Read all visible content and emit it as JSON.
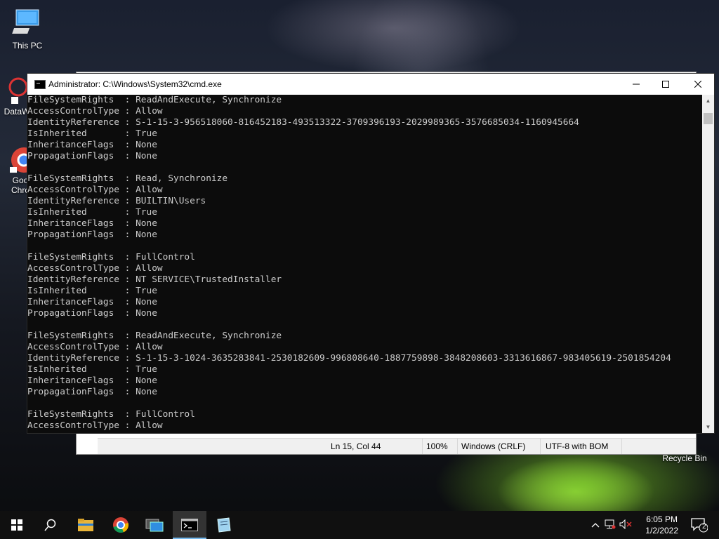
{
  "desktop": {
    "icons": [
      {
        "label": "This PC"
      },
      {
        "label": "DataW"
      },
      {
        "label": "Goo Chro"
      },
      {
        "label": "Recycle Bin"
      }
    ]
  },
  "notepad": {
    "status": {
      "position": "Ln 15, Col 44",
      "zoom": "100%",
      "line_ending": "Windows (CRLF)",
      "encoding": "UTF-8 with BOM"
    }
  },
  "cmd": {
    "title": "Administrator: C:\\Windows\\System32\\cmd.exe",
    "lines": [
      "FileSystemRights  : ReadAndExecute, Synchronize",
      "AccessControlType : Allow",
      "IdentityReference : S-1-15-3-956518060-816452183-493513322-3709396193-2029989365-3576685034-1160945664",
      "IsInherited       : True",
      "InheritanceFlags  : None",
      "PropagationFlags  : None",
      "",
      "FileSystemRights  : Read, Synchronize",
      "AccessControlType : Allow",
      "IdentityReference : BUILTIN\\Users",
      "IsInherited       : True",
      "InheritanceFlags  : None",
      "PropagationFlags  : None",
      "",
      "FileSystemRights  : FullControl",
      "AccessControlType : Allow",
      "IdentityReference : NT SERVICE\\TrustedInstaller",
      "IsInherited       : True",
      "InheritanceFlags  : None",
      "PropagationFlags  : None",
      "",
      "FileSystemRights  : ReadAndExecute, Synchronize",
      "AccessControlType : Allow",
      "IdentityReference : S-1-15-3-1024-3635283841-2530182609-996808640-1887759898-3848208603-3313616867-983405619-2501854204",
      "IsInherited       : True",
      "InheritanceFlags  : None",
      "PropagationFlags  : None",
      "",
      "FileSystemRights  : FullControl",
      "AccessControlType : Allow"
    ]
  },
  "taskbar": {
    "time": "6:05 PM",
    "date": "1/2/2022",
    "notification_count": "2"
  }
}
